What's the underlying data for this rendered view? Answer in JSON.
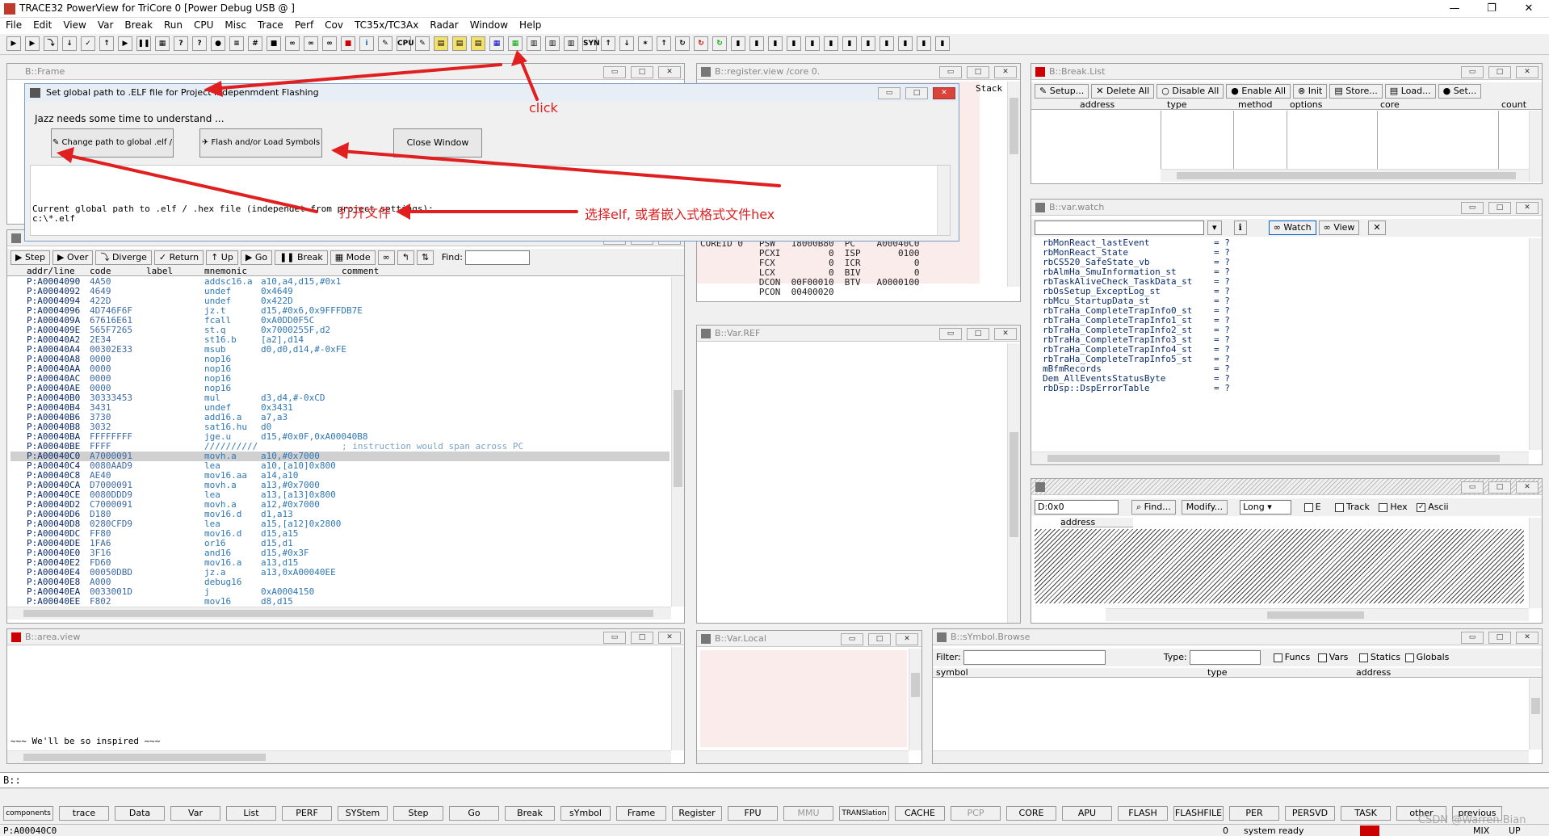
{
  "app": {
    "title": "TRACE32 PowerView for TriCore 0 [Power Debug USB @ ]",
    "window_controls": [
      "—",
      "❐",
      "✕"
    ]
  },
  "menu": [
    "File",
    "Edit",
    "View",
    "Var",
    "Break",
    "Run",
    "CPU",
    "Misc",
    "Trace",
    "Perf",
    "Cov",
    "TC35x/TC3Ax",
    "Radar",
    "Window",
    "Help"
  ],
  "toolbar_labels": [
    "CPU",
    "SYN"
  ],
  "frame_window": {
    "title": "B::Frame"
  },
  "register_window": {
    "title": "B::register.view /core 0.",
    "stack_label": "Stack",
    "registers": [
      "COREID 0   PSW   18000B80  PC    A00040C0",
      "           PCXI         0  ISP       0100",
      "           FCX          0  ICR          0",
      "           LCX          0  BIV          0",
      "           DCON  00F00010  BTV   A0000100",
      "           PCON  00400020"
    ]
  },
  "break_window": {
    "title": "B::Break.List",
    "buttons": [
      "Setup...",
      "Delete All",
      "Disable All",
      "Enable All",
      "Init",
      "Store...",
      "Load...",
      "Set..."
    ],
    "columns": [
      "address",
      "type",
      "method",
      "options",
      "core",
      "count"
    ]
  },
  "dialog": {
    "title": "Set global path to .ELF file for Project indepenmdent Flashing",
    "message": "Jazz needs some time to understand ...",
    "buttons": [
      "Change path to global .elf / .hex file",
      "Flash and/or Load Symbols",
      "Close Window"
    ],
    "path_label": "Current global path to .elf / .hex file (independet from project settings):",
    "path_value": "c:\\*.elf"
  },
  "list_window": {
    "buttons": [
      "Step",
      "Over",
      "Diverge",
      "Return",
      "Up",
      "Go",
      "Break",
      "Mode"
    ],
    "find_label": "Find:",
    "columns": [
      "addr/line",
      "code",
      "label",
      "mnemonic",
      "comment"
    ],
    "rows": [
      [
        "P:A0004090",
        "4A50",
        "",
        "addsc16.a",
        "a10,a4,d15,#0x1",
        ""
      ],
      [
        "P:A0004092",
        "4649",
        "",
        "undef",
        "0x4649",
        ""
      ],
      [
        "P:A0004094",
        "422D",
        "",
        "undef",
        "0x422D",
        ""
      ],
      [
        "P:A0004096",
        "4D746F6F",
        "",
        "jz.t",
        "d15,#0x6,0x9FFFDB7E",
        ""
      ],
      [
        "P:A000409A",
        "67616E61",
        "",
        "fcall",
        "0xA0DD0F5C",
        ""
      ],
      [
        "P:A000409E",
        "565F7265",
        "",
        "st.q",
        "0x7000255F,d2",
        ""
      ],
      [
        "P:A00040A2",
        "2E34",
        "",
        "st16.b",
        "[a2],d14",
        ""
      ],
      [
        "P:A00040A4",
        "00302E33",
        "",
        "msub",
        "d0,d0,d14,#-0xFE",
        ""
      ],
      [
        "P:A00040A8",
        "0000",
        "",
        "nop16",
        "",
        ""
      ],
      [
        "P:A00040AA",
        "0000",
        "",
        "nop16",
        "",
        ""
      ],
      [
        "P:A00040AC",
        "0000",
        "",
        "nop16",
        "",
        ""
      ],
      [
        "P:A00040AE",
        "0000",
        "",
        "nop16",
        "",
        ""
      ],
      [
        "P:A00040B0",
        "30333453",
        "",
        "mul",
        "d3,d4,#-0xCD",
        ""
      ],
      [
        "P:A00040B4",
        "3431",
        "",
        "undef",
        "0x3431",
        ""
      ],
      [
        "P:A00040B6",
        "3730",
        "",
        "add16.a",
        "a7,a3",
        ""
      ],
      [
        "P:A00040B8",
        "3032",
        "",
        "sat16.hu",
        "d0",
        ""
      ],
      [
        "P:A00040BA",
        "FFFFFFFF",
        "",
        "jge.u",
        "d15,#0x0F,0xA00040B8",
        ""
      ],
      [
        "P:A00040BE",
        "FFFF",
        "",
        "//////////",
        "",
        "; instruction would span across PC"
      ],
      [
        "P:A00040C0",
        "A7000091",
        "",
        "movh.a",
        "a10,#0x7000",
        ""
      ],
      [
        "P:A00040C4",
        "0080AAD9",
        "",
        "lea",
        "a10,[a10]0x800",
        ""
      ],
      [
        "P:A00040C8",
        "AE40",
        "",
        "mov16.aa",
        "a14,a10",
        ""
      ],
      [
        "P:A00040CA",
        "D7000091",
        "",
        "movh.a",
        "a13,#0x7000",
        ""
      ],
      [
        "P:A00040CE",
        "0080DDD9",
        "",
        "lea",
        "a13,[a13]0x800",
        ""
      ],
      [
        "P:A00040D2",
        "C7000091",
        "",
        "movh.a",
        "a12,#0x7000",
        ""
      ],
      [
        "P:A00040D6",
        "D180",
        "",
        "mov16.d",
        "d1,a13",
        ""
      ],
      [
        "P:A00040D8",
        "0280CFD9",
        "",
        "lea",
        "a15,[a12]0x2800",
        ""
      ],
      [
        "P:A00040DC",
        "FF80",
        "",
        "mov16.d",
        "d15,a15",
        ""
      ],
      [
        "P:A00040DE",
        "1FA6",
        "",
        "or16",
        "d15,d1",
        ""
      ],
      [
        "P:A00040E0",
        "3F16",
        "",
        "and16",
        "d15,#0x3F",
        ""
      ],
      [
        "P:A00040E2",
        "FD60",
        "",
        "mov16.a",
        "a13,d15",
        ""
      ],
      [
        "P:A00040E4",
        "00050DBD",
        "",
        "jz.a",
        "a13,0xA00040EE",
        ""
      ],
      [
        "P:A00040E8",
        "A000",
        "",
        "debug16",
        "",
        ""
      ],
      [
        "P:A00040EA",
        "0033001D",
        "",
        "j",
        "0xA0004150",
        ""
      ],
      [
        "P:A00040EE",
        "F802",
        "",
        "mov16",
        "d8,d15",
        ""
      ]
    ]
  },
  "varref_window": {
    "title": "B::Var.REF"
  },
  "watch_window": {
    "title": "B::var.watch",
    "buttons": [
      "Watch",
      "View"
    ],
    "items": [
      [
        "rbMonReact_lastEvent",
        "= ?"
      ],
      [
        "rbMonReact_State",
        "= ?"
      ],
      [
        "rbCS520_SafeState_vb",
        "= ?"
      ],
      [
        "rbAlmHa_SmuInformation_st",
        "= ?"
      ],
      [
        "rbTaskAliveCheck_TaskData_st",
        "= ?"
      ],
      [
        "rbOsSetup_ExceptLog_st",
        "= ?"
      ],
      [
        "rbMcu_StartupData_st",
        "= ?"
      ],
      [
        "rbTraHa_CompleteTrapInfo0_st",
        "= ?"
      ],
      [
        "rbTraHa_CompleteTrapInfo1_st",
        "= ?"
      ],
      [
        "rbTraHa_CompleteTrapInfo2_st",
        "= ?"
      ],
      [
        "rbTraHa_CompleteTrapInfo3_st",
        "= ?"
      ],
      [
        "rbTraHa_CompleteTrapInfo4_st",
        "= ?"
      ],
      [
        "rbTraHa_CompleteTrapInfo5_st",
        "= ?"
      ],
      [
        "mBfmRecords",
        "= ?"
      ],
      [
        "Dem_AllEventsStatusByte",
        "= ?"
      ],
      [
        "rbDsp::DspErrorTable",
        "= ?"
      ]
    ]
  },
  "dump_window": {
    "address": "D:0x0",
    "find_label": "Find...",
    "modify_label": "Modify...",
    "format": "Long",
    "checks": [
      "E",
      "Track",
      "Hex",
      "Ascii"
    ],
    "column": "address"
  },
  "area_window": {
    "title": "B::area.view",
    "text": "~~~ We'll be so inspired ~~~"
  },
  "varlocal_window": {
    "title": "B::Var.Local"
  },
  "symbol_window": {
    "title": "B::sYmbol.Browse",
    "filter_label": "Filter:",
    "type_label": "Type:",
    "checks": [
      "Funcs",
      "Vars",
      "Statics",
      "Globals"
    ],
    "columns": [
      "symbol",
      "type",
      "address"
    ]
  },
  "annotations": {
    "click": "click",
    "open_file": "打开文件",
    "select_elf": "选择elf, 或者嵌入式格式文件hex"
  },
  "command_line": "B::",
  "bottom_buttons": [
    "components",
    "trace",
    "Data",
    "Var",
    "List",
    "PERF",
    "SYStem",
    "Step",
    "Go",
    "Break",
    "sYmbol",
    "Frame",
    "Register",
    "FPU",
    "MMU",
    "TRANSlation",
    "CACHE",
    "PCP",
    "CORE",
    "APU",
    "FLASH",
    "FLASHFILE",
    "PER",
    "PERSVD",
    "TASK",
    "other",
    "previous"
  ],
  "status": {
    "address": "P:A00040C0",
    "num": "0",
    "state": "system ready",
    "mode": "MIX",
    "up": "UP",
    "watermark": "CSDN @Warren.Bian"
  },
  "colors": {
    "annotation_red": "#e02020",
    "dialog_title_bg": "#e8eef6",
    "code_blue": "#0e5aa7"
  }
}
